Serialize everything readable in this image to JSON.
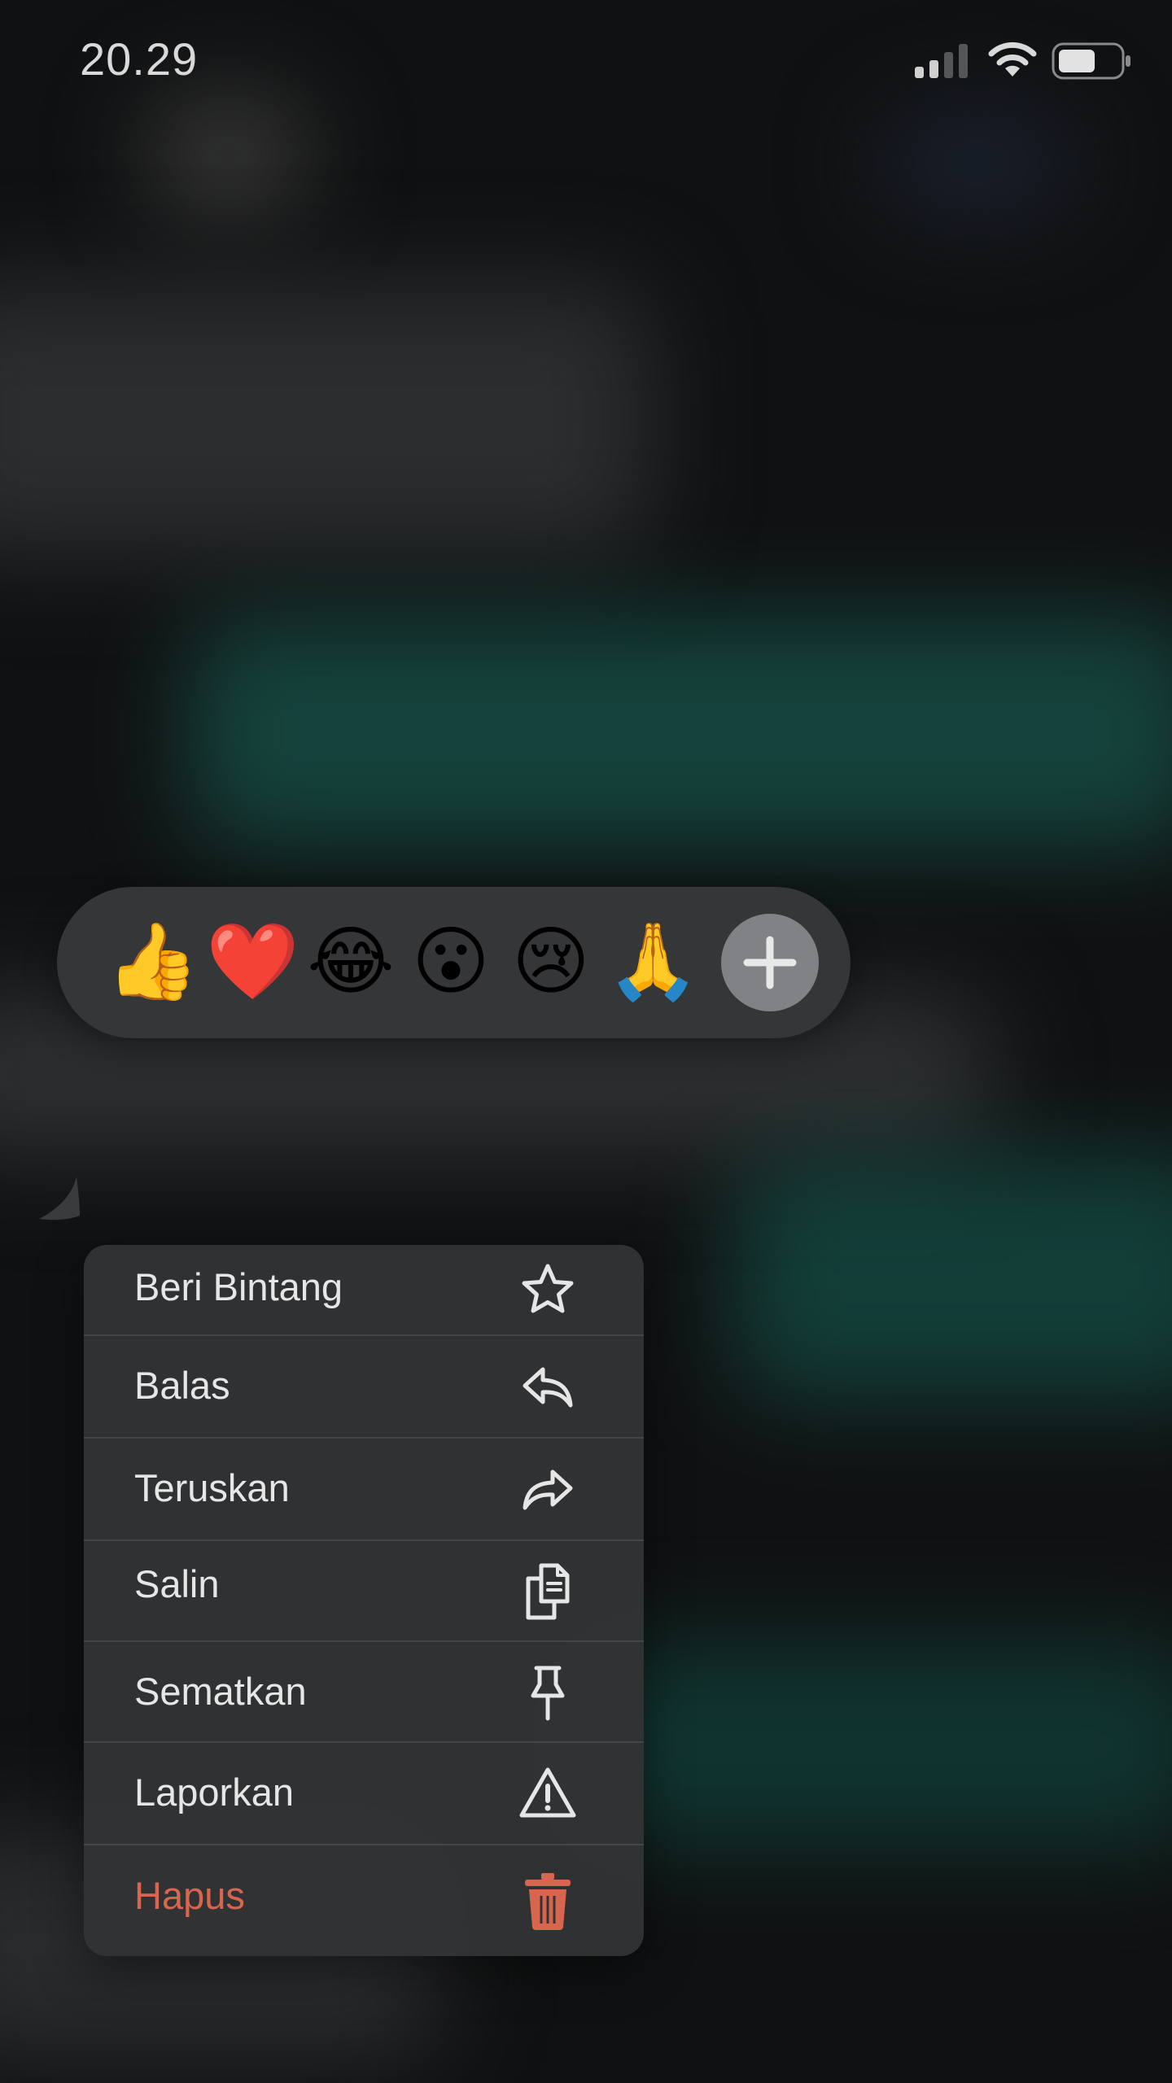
{
  "status_bar": {
    "time": "20.29",
    "signal_icon": "cellular-signal-icon",
    "wifi_icon": "wifi-icon",
    "battery_icon": "battery-icon"
  },
  "reactions": {
    "items": [
      {
        "emoji": "👍",
        "icon": "thumbs-up"
      },
      {
        "emoji": "❤️",
        "icon": "red-heart"
      },
      {
        "emoji": "😂",
        "icon": "tears-of-joy"
      },
      {
        "emoji": "😮",
        "icon": "surprised-face"
      },
      {
        "emoji": "😢",
        "icon": "crying-face"
      },
      {
        "emoji": "🙏",
        "icon": "folded-hands"
      }
    ],
    "more_icon": "plus-icon"
  },
  "context_menu": {
    "items": [
      {
        "label": "Beri Bintang",
        "icon": "star-icon"
      },
      {
        "label": "Balas",
        "icon": "reply-icon"
      },
      {
        "label": "Teruskan",
        "icon": "forward-icon"
      },
      {
        "label": "Salin",
        "icon": "copy-icon"
      },
      {
        "label": "Sematkan",
        "icon": "pin-icon"
      },
      {
        "label": "Laporkan",
        "icon": "warning-icon"
      },
      {
        "label": "Hapus",
        "icon": "trash-icon",
        "destructive": true
      }
    ]
  },
  "colors": {
    "destructive": "#d8664f",
    "menu_text": "#e6e6e6",
    "menu_background": "#323335",
    "reaction_bar_background": "#353637"
  }
}
